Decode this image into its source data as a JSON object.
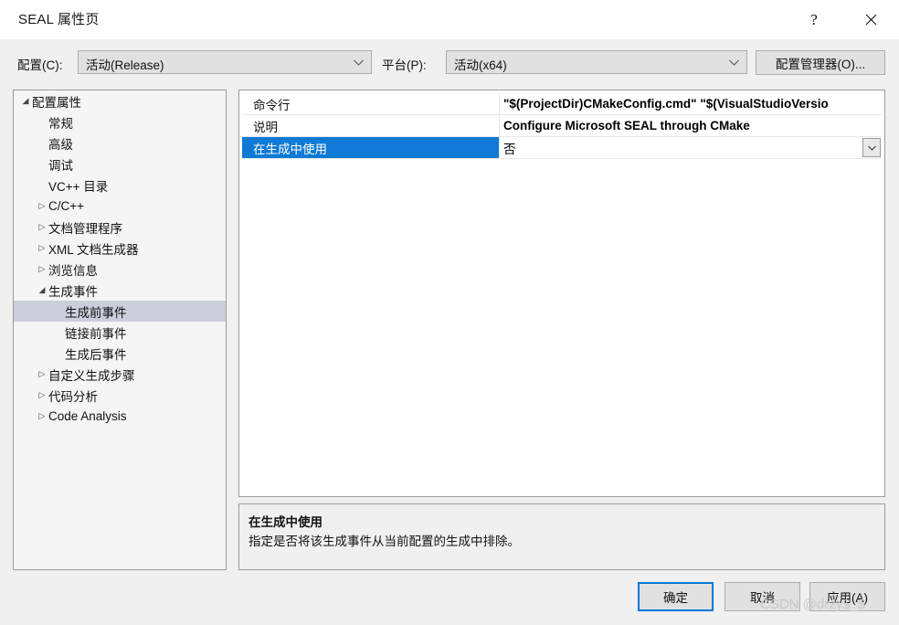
{
  "window": {
    "title": "SEAL 属性页",
    "help_button": "?",
    "close_button": "✕"
  },
  "config_bar": {
    "config_label": "配置(C):",
    "config_value": "活动(Release)",
    "platform_label": "平台(P):",
    "platform_value": "活动(x64)",
    "config_manager_button": "配置管理器(O)..."
  },
  "tree": {
    "items": [
      {
        "label": "配置属性",
        "indent": 0,
        "expander": "expanded",
        "selected": false
      },
      {
        "label": "常规",
        "indent": 1,
        "expander": "none",
        "selected": false
      },
      {
        "label": "高级",
        "indent": 1,
        "expander": "none",
        "selected": false
      },
      {
        "label": "调试",
        "indent": 1,
        "expander": "none",
        "selected": false
      },
      {
        "label": "VC++ 目录",
        "indent": 1,
        "expander": "none",
        "selected": false
      },
      {
        "label": "C/C++",
        "indent": 1,
        "expander": "collapsed",
        "selected": false
      },
      {
        "label": "文档管理程序",
        "indent": 1,
        "expander": "collapsed",
        "selected": false
      },
      {
        "label": "XML 文档生成器",
        "indent": 1,
        "expander": "collapsed",
        "selected": false
      },
      {
        "label": "浏览信息",
        "indent": 1,
        "expander": "collapsed",
        "selected": false
      },
      {
        "label": "生成事件",
        "indent": 1,
        "expander": "expanded",
        "selected": false
      },
      {
        "label": "生成前事件",
        "indent": 2,
        "expander": "none",
        "selected": true
      },
      {
        "label": "链接前事件",
        "indent": 2,
        "expander": "none",
        "selected": false
      },
      {
        "label": "生成后事件",
        "indent": 2,
        "expander": "none",
        "selected": false
      },
      {
        "label": "自定义生成步骤",
        "indent": 1,
        "expander": "collapsed",
        "selected": false
      },
      {
        "label": "代码分析",
        "indent": 1,
        "expander": "collapsed",
        "selected": false
      },
      {
        "label": "Code Analysis",
        "indent": 1,
        "expander": "collapsed",
        "selected": false
      }
    ]
  },
  "property_grid": {
    "rows": [
      {
        "name": "命令行",
        "value": "\"$(ProjectDir)CMakeConfig.cmd\" \"$(VisualStudioVersio",
        "bold": true,
        "selected": false,
        "has_dropdown": false
      },
      {
        "name": "说明",
        "value": "Configure Microsoft SEAL through CMake",
        "bold": true,
        "selected": false,
        "has_dropdown": false
      },
      {
        "name": "在生成中使用",
        "value": "否",
        "bold": false,
        "selected": true,
        "has_dropdown": true
      }
    ]
  },
  "description": {
    "title": "在生成中使用",
    "text": "指定是否将该生成事件从当前配置的生成中排除。"
  },
  "buttons": {
    "ok": "确定",
    "cancel": "取消",
    "apply": "应用(A)"
  },
  "watermark": "CSDN @drzy$_$",
  "colors": {
    "accent_selection": "#0f7ad6",
    "tree_selection": "#cccedb",
    "dialog_background": "#f0f0f0",
    "focus_border": "#0078d7"
  }
}
